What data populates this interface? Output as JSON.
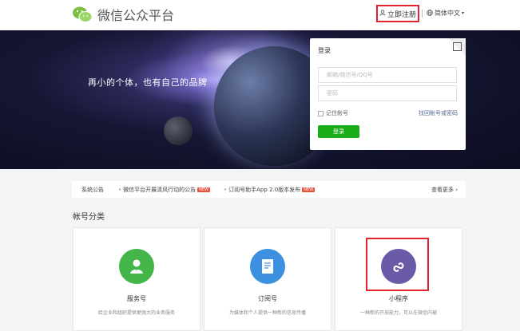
{
  "header": {
    "logo_text": "微信公众平台",
    "register_label": "立即注册",
    "language_label": "简体中文"
  },
  "banner": {
    "slogan": "再小的个体，也有自己的品牌"
  },
  "login": {
    "title": "登录",
    "account_placeholder": "邮箱/微信号/QQ号",
    "password_placeholder": "密码",
    "remember_label": "记住帐号",
    "forgot_label": "找回帐号或密码",
    "submit_label": "登录"
  },
  "notice": {
    "label": "系统公告",
    "items": [
      {
        "text": "微信平台开展清风行动的公告",
        "badge": "NEW"
      },
      {
        "text": "订阅号助手App 2.0版本发布",
        "badge": "NEW"
      }
    ],
    "more_label": "查看更多"
  },
  "section": {
    "title": "帐号分类"
  },
  "cards": [
    {
      "name": "服务号",
      "desc": "给企业和组织提供更强大的业务服务",
      "color": "#44b549"
    },
    {
      "name": "订阅号",
      "desc": "为媒体和个人提供一种新的信息传播",
      "color": "#3d8fe0"
    },
    {
      "name": "小程序",
      "desc": "一种新的开放能力，可以在微信内被",
      "color": "#6a5aa8"
    }
  ],
  "colors": {
    "brand_green": "#1aad19",
    "highlight_red": "#e0232f"
  }
}
